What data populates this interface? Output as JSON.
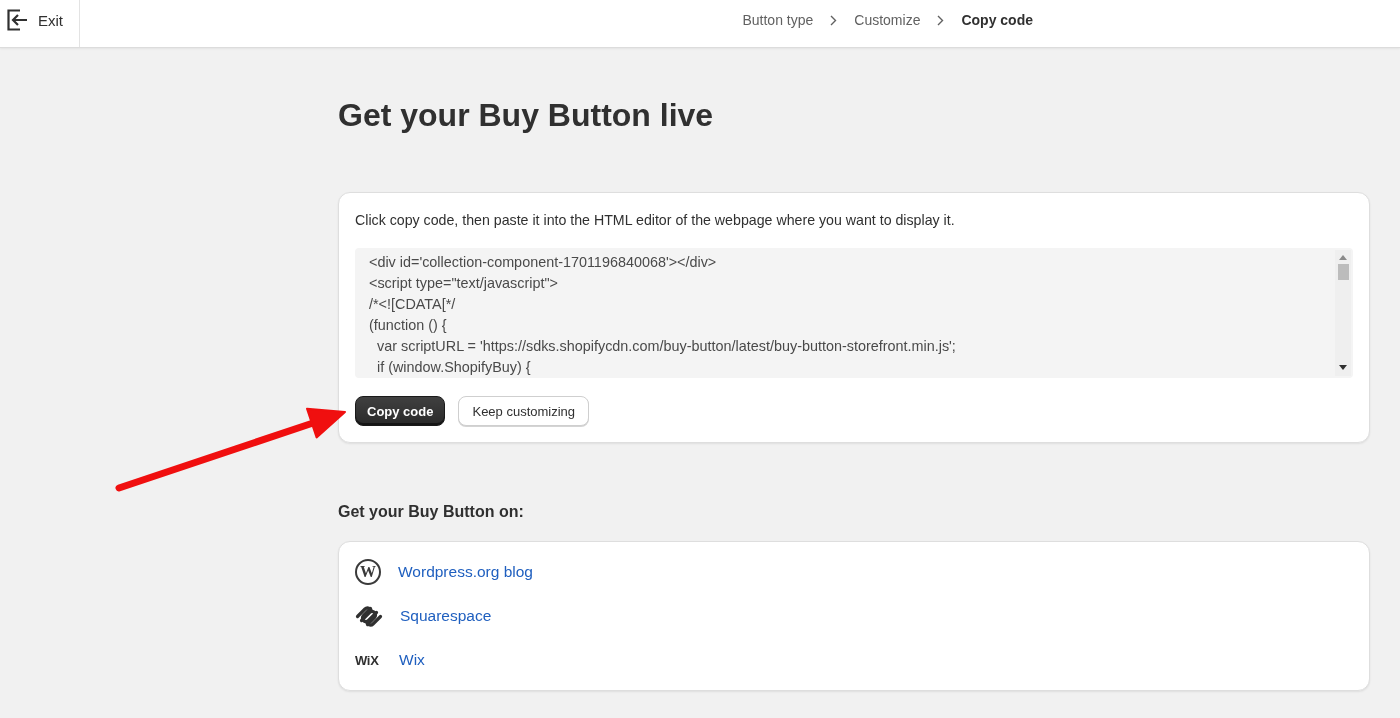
{
  "topbar": {
    "exit": {
      "label": "Exit"
    },
    "breadcrumb": [
      {
        "label": "Button type",
        "current": false
      },
      {
        "label": "Customize",
        "current": false
      },
      {
        "label": "Copy code",
        "current": true
      }
    ]
  },
  "title": "Get your Buy Button live",
  "code_card": {
    "instructions": "Click copy code, then paste it into the HTML editor of the webpage where you want to display it.",
    "code_lines": [
      "<div id='collection-component-1701196840068'></div>",
      "<script type=\"text/javascript\">",
      "/*<![CDATA[*/",
      "(function () {",
      "  var scriptURL = 'https://sdks.shopifycdn.com/buy-button/latest/buy-button-storefront.min.js';",
      "  if (window.ShopifyBuy) {"
    ],
    "buttons": [
      {
        "label": "Copy code",
        "kind": "primary"
      },
      {
        "label": "Keep customizing",
        "kind": "secondary"
      }
    ]
  },
  "platforms": {
    "heading": "Get your Buy Button on:",
    "items": [
      {
        "kind": "ring",
        "mark": "W",
        "label": "Wordpress.org blog"
      },
      {
        "kind": "loops",
        "label": "Squarespace"
      },
      {
        "kind": "wordmark",
        "mark": "WiX",
        "label": "Wix"
      }
    ]
  }
}
